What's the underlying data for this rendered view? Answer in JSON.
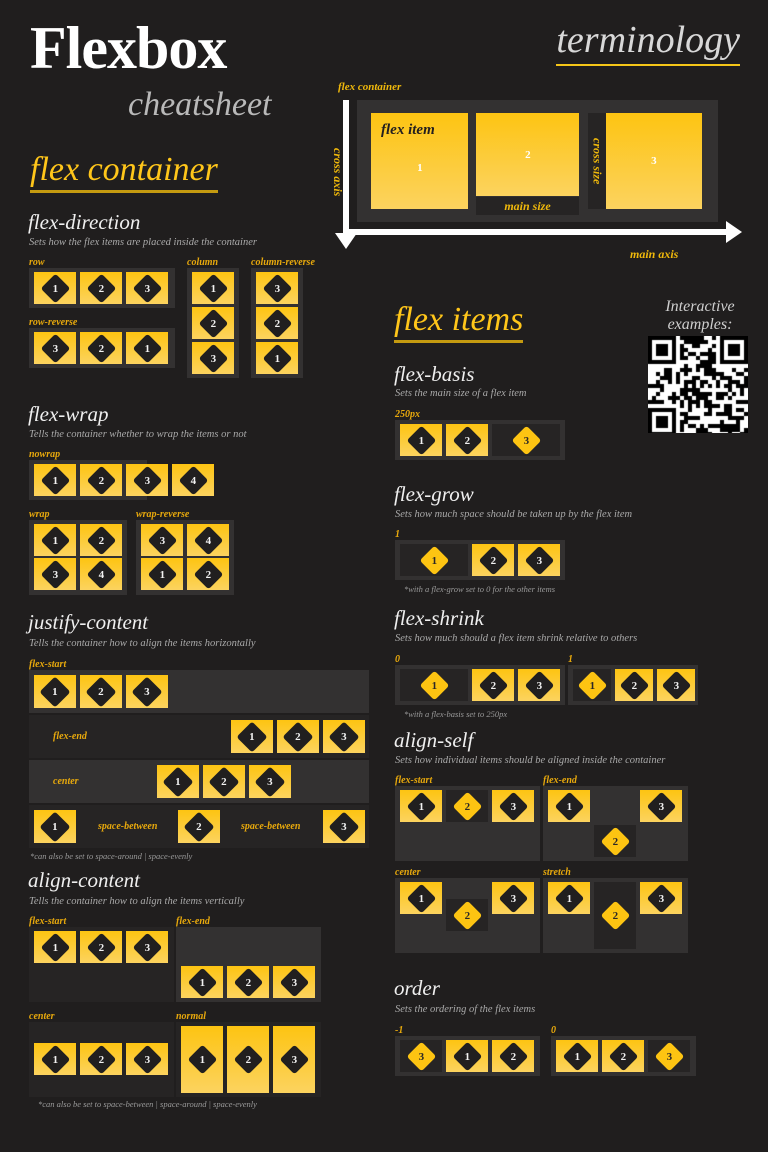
{
  "header": {
    "title": "Flexbox",
    "subtitle": "cheatsheet",
    "terminology_title": "terminology"
  },
  "sections": {
    "flex_container": "flex container",
    "flex_items": "flex items"
  },
  "terminology": {
    "flex_container_label": "flex container",
    "flex_item_label": "flex item",
    "cross_axis_label": "cross axis",
    "main_axis_label": "main axis",
    "main_size_label": "main size",
    "cross_size_label": "cross size",
    "items": [
      "1",
      "2",
      "3"
    ]
  },
  "qr": {
    "caption_line1": "Interactive",
    "caption_line2": "examples:"
  },
  "properties": {
    "flex_direction": {
      "name": "flex-direction",
      "desc": "Sets how the flex items are placed inside the container",
      "examples": [
        {
          "label": "row",
          "items": [
            "1",
            "2",
            "3"
          ]
        },
        {
          "label": "row-reverse",
          "items": [
            "3",
            "2",
            "1"
          ]
        },
        {
          "label": "column",
          "items": [
            "1",
            "2",
            "3"
          ]
        },
        {
          "label": "column-reverse",
          "items": [
            "3",
            "2",
            "1"
          ]
        }
      ]
    },
    "flex_wrap": {
      "name": "flex-wrap",
      "desc": "Tells the container whether to wrap the items or not",
      "examples": [
        {
          "label": "nowrap",
          "items": [
            "1",
            "2",
            "3",
            "4"
          ]
        },
        {
          "label": "wrap",
          "items": [
            "1",
            "2",
            "3",
            "4"
          ]
        },
        {
          "label": "wrap-reverse",
          "items": [
            "3",
            "4",
            "1",
            "2"
          ]
        }
      ]
    },
    "justify_content": {
      "name": "justify-content",
      "desc": "Tells the container how to align the items horizontally",
      "note": "*can also be set to space-around | space-evenly",
      "rows": [
        {
          "label": "flex-start",
          "items": [
            "1",
            "2",
            "3"
          ]
        },
        {
          "label": "flex-end",
          "items": [
            "1",
            "2",
            "3"
          ]
        },
        {
          "label": "center",
          "items": [
            "1",
            "2",
            "3"
          ]
        },
        {
          "label": "space-between",
          "label2": "space-between",
          "items": [
            "1",
            "2",
            "3"
          ]
        }
      ]
    },
    "align_content": {
      "name": "align-content",
      "desc": "Tells the container how to align the items vertically",
      "note": "*can also be set to space-between | space-around | space-evenly",
      "quadrants": [
        {
          "label": "flex-start",
          "items": [
            "1",
            "2",
            "3"
          ]
        },
        {
          "label": "flex-end",
          "items": [
            "1",
            "2",
            "3"
          ]
        },
        {
          "label": "center",
          "items": [
            "1",
            "2",
            "3"
          ]
        },
        {
          "label": "normal",
          "items": [
            "1",
            "2",
            "3"
          ]
        }
      ]
    },
    "flex_basis": {
      "name": "flex-basis",
      "desc": "Sets the main size of a flex item",
      "value_label": "250px",
      "items": [
        "1",
        "2",
        "3"
      ]
    },
    "flex_grow": {
      "name": "flex-grow",
      "desc": "Sets how much space should be taken up by the flex item",
      "value_label": "1",
      "note": "*with a flex-grow set to 0 for the other items",
      "items": [
        "1",
        "2",
        "3"
      ]
    },
    "flex_shrink": {
      "name": "flex-shrink",
      "desc": "Sets how much should a flex item shrink relative to others",
      "note": "*with a flex-basis set to 250px",
      "examples": [
        {
          "label": "0",
          "items": [
            "1",
            "2",
            "3"
          ]
        },
        {
          "label": "1",
          "items": [
            "1",
            "2",
            "3"
          ]
        }
      ]
    },
    "align_self": {
      "name": "align-self",
      "desc": "Sets how individual items should be aligned inside the container",
      "quadrants": [
        {
          "label": "flex-start",
          "items": [
            "1",
            "2",
            "3"
          ]
        },
        {
          "label": "flex-end",
          "items": [
            "1",
            "2",
            "3"
          ]
        },
        {
          "label": "center",
          "items": [
            "1",
            "2",
            "3"
          ]
        },
        {
          "label": "stretch",
          "items": [
            "1",
            "2",
            "3"
          ]
        }
      ]
    },
    "order": {
      "name": "order",
      "desc": "Sets the ordering of the flex items",
      "examples": [
        {
          "label": "-1",
          "items": [
            "3",
            "1",
            "2"
          ]
        },
        {
          "label": "0",
          "items": [
            "1",
            "2",
            "3"
          ]
        }
      ]
    }
  },
  "colors": {
    "background": "#201e1e",
    "accent_yellow": "#fdc412",
    "label_yellow": "#e8a90c",
    "panel": "#333131",
    "panel_dark": "#262424",
    "text_light": "#efefef",
    "text_muted": "#a9a9a9"
  }
}
